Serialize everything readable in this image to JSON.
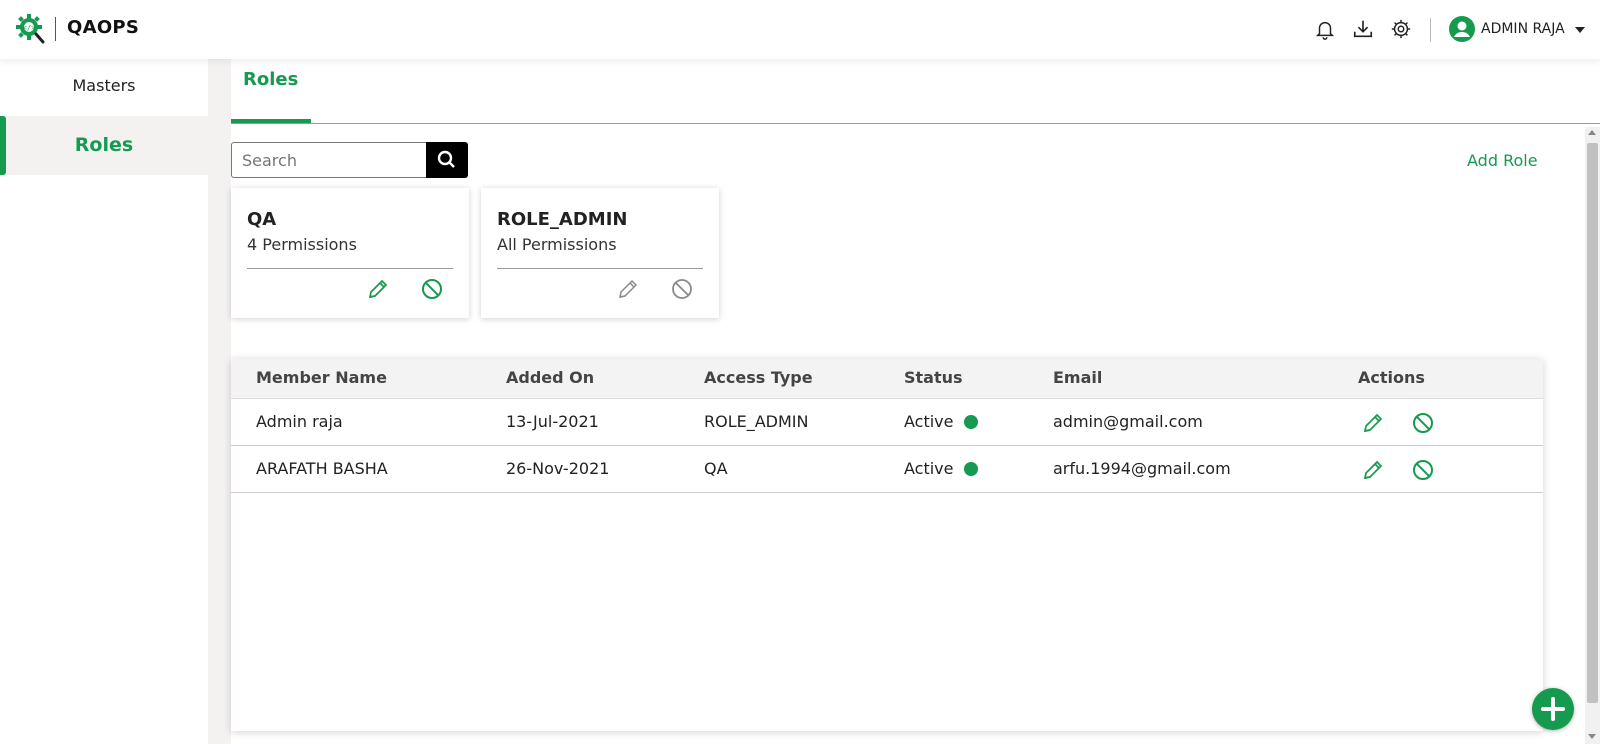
{
  "app": {
    "title": "QAOPS"
  },
  "header": {
    "user_name": "ADMIN RAJA",
    "icons": [
      "bell-icon",
      "download-icon",
      "settings-icon",
      "user-avatar-icon"
    ]
  },
  "sidebar": {
    "items": [
      {
        "label": "Masters",
        "active": false
      },
      {
        "label": "Roles",
        "active": true
      }
    ]
  },
  "main": {
    "tab_label": "Roles",
    "search_placeholder": "Search",
    "add_role_label": "Add Role",
    "role_cards": [
      {
        "name": "QA",
        "permissions": "4 Permissions",
        "actions_enabled": true
      },
      {
        "name": "ROLE_ADMIN",
        "permissions": "All Permissions",
        "actions_enabled": false
      }
    ],
    "table": {
      "headers": [
        "Member Name",
        "Added On",
        "Access Type",
        "Status",
        "Email",
        "Actions"
      ],
      "rows": [
        {
          "name": "Admin raja",
          "added_on": "13-Jul-2021",
          "access_type": "ROLE_ADMIN",
          "status": "Active",
          "email": "admin@gmail.com"
        },
        {
          "name": "ARAFATH BASHA",
          "added_on": "26-Nov-2021",
          "access_type": "QA",
          "status": "Active",
          "email": "arfu.1994@gmail.com"
        }
      ]
    }
  },
  "colors": {
    "accent": "#159a4f",
    "disabled_icon": "#8a8a8a",
    "background": "#f4f2f1"
  }
}
